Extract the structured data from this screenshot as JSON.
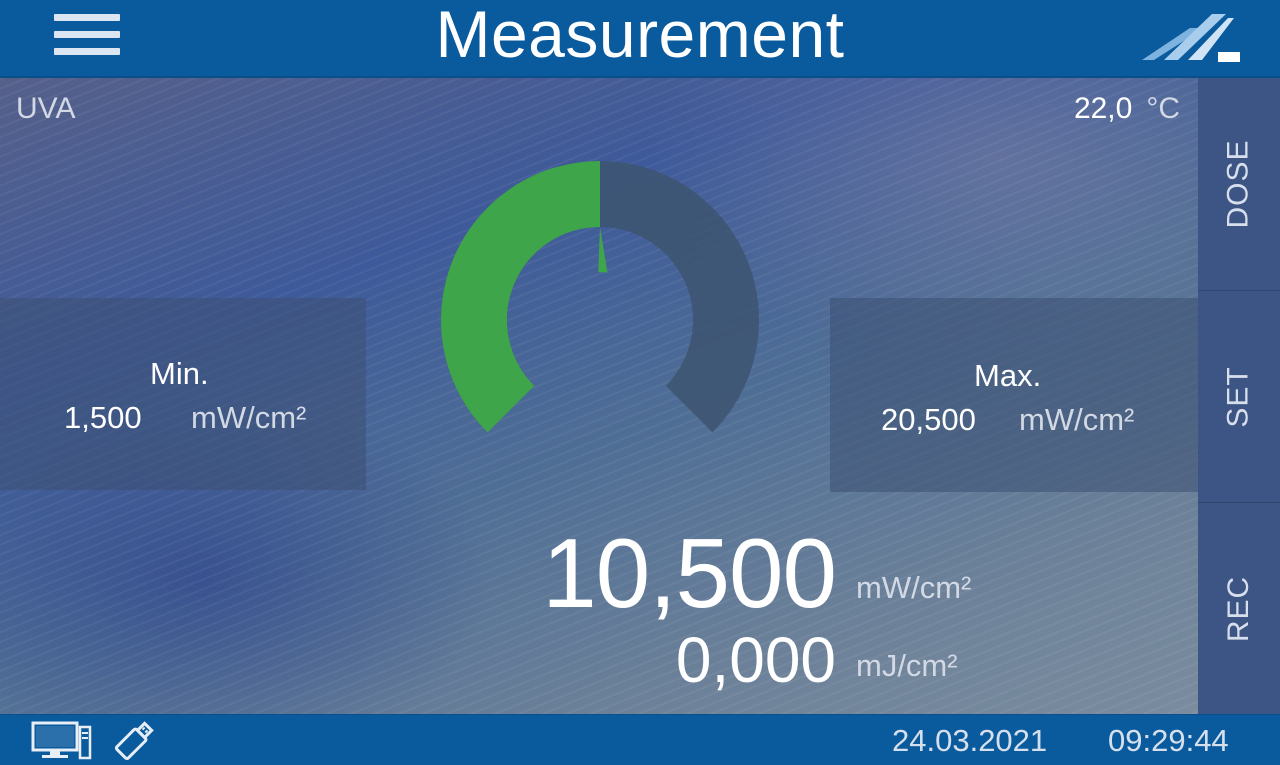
{
  "header": {
    "title": "Measurement",
    "menu_icon": "hamburger-icon",
    "logo_icon": "brand-logo-icon"
  },
  "status": {
    "channel": "UVA",
    "temperature": "22,0",
    "temperature_unit": "°C"
  },
  "min": {
    "label": "Min.",
    "value": "1,500",
    "unit": "mW/cm²"
  },
  "max": {
    "label": "Max.",
    "value": "20,500",
    "unit": "mW/cm²"
  },
  "reading": {
    "value": "10,500",
    "unit": "mW/cm²",
    "dose_value": "0,000",
    "dose_unit": "mJ/cm²"
  },
  "sidebar": {
    "buttons": [
      "DOSE",
      "SET",
      "REC"
    ]
  },
  "footer": {
    "date": "24.03.2021",
    "time": "09:29:44",
    "pc_icon": "pc-connection-icon",
    "usb_icon": "usb-stick-icon"
  },
  "gauge": {
    "level_fraction": 0.5
  },
  "colors": {
    "header": "#0a5b9e",
    "gauge_fill": "#3fa54a",
    "gauge_track": "#3d5570",
    "sidebar": "#3d5585"
  }
}
